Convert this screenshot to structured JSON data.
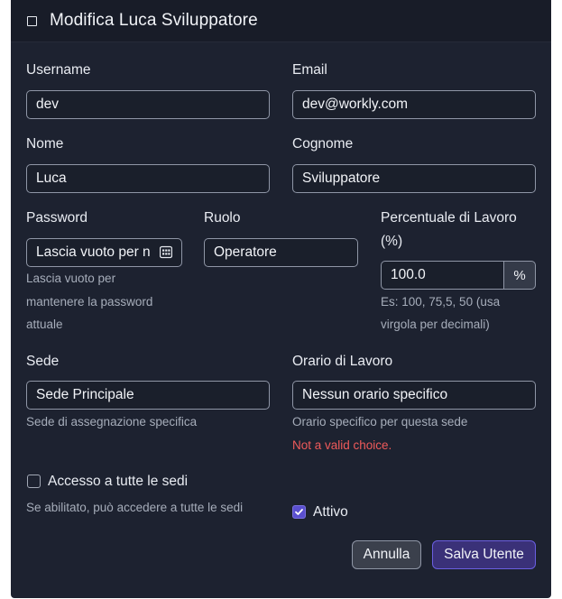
{
  "header": {
    "title": "Modifica Luca Sviluppatore",
    "icon": "square-icon"
  },
  "fields": {
    "username": {
      "label": "Username",
      "value": "dev"
    },
    "email": {
      "label": "Email",
      "value": "dev@workly.com"
    },
    "nome": {
      "label": "Nome",
      "value": "Luca"
    },
    "cognome": {
      "label": "Cognome",
      "value": "Sviluppatore"
    },
    "password": {
      "label": "Password",
      "value": "Lascia vuoto per n",
      "help1": "Lascia vuoto per",
      "help2": "mantenere la password",
      "help3": "attuale"
    },
    "ruolo": {
      "label": "Ruolo",
      "value": "Operatore"
    },
    "percentuale": {
      "label1": "Percentuale di Lavoro",
      "label2": "(%)",
      "value": "100.0",
      "addon": "%",
      "help1": "Es: 100, 75,5, 50 (usa",
      "help2": "virgola per decimali)"
    },
    "sede": {
      "label": "Sede",
      "value": "Sede Principale",
      "help": "Sede di assegnazione specifica"
    },
    "orario": {
      "label": "Orario di Lavoro",
      "value": "Nessun orario specifico",
      "help": "Orario specifico per questa sede",
      "error": "Not a valid choice."
    }
  },
  "checks": {
    "all_sedi": {
      "label": "Accesso a tutte le sedi",
      "help": "Se abilitato, può accedere a tutte le sedi",
      "checked": false
    },
    "attivo": {
      "label": "Attivo",
      "checked": true
    }
  },
  "buttons": {
    "cancel": "Annulla",
    "save": "Salva Utente"
  }
}
